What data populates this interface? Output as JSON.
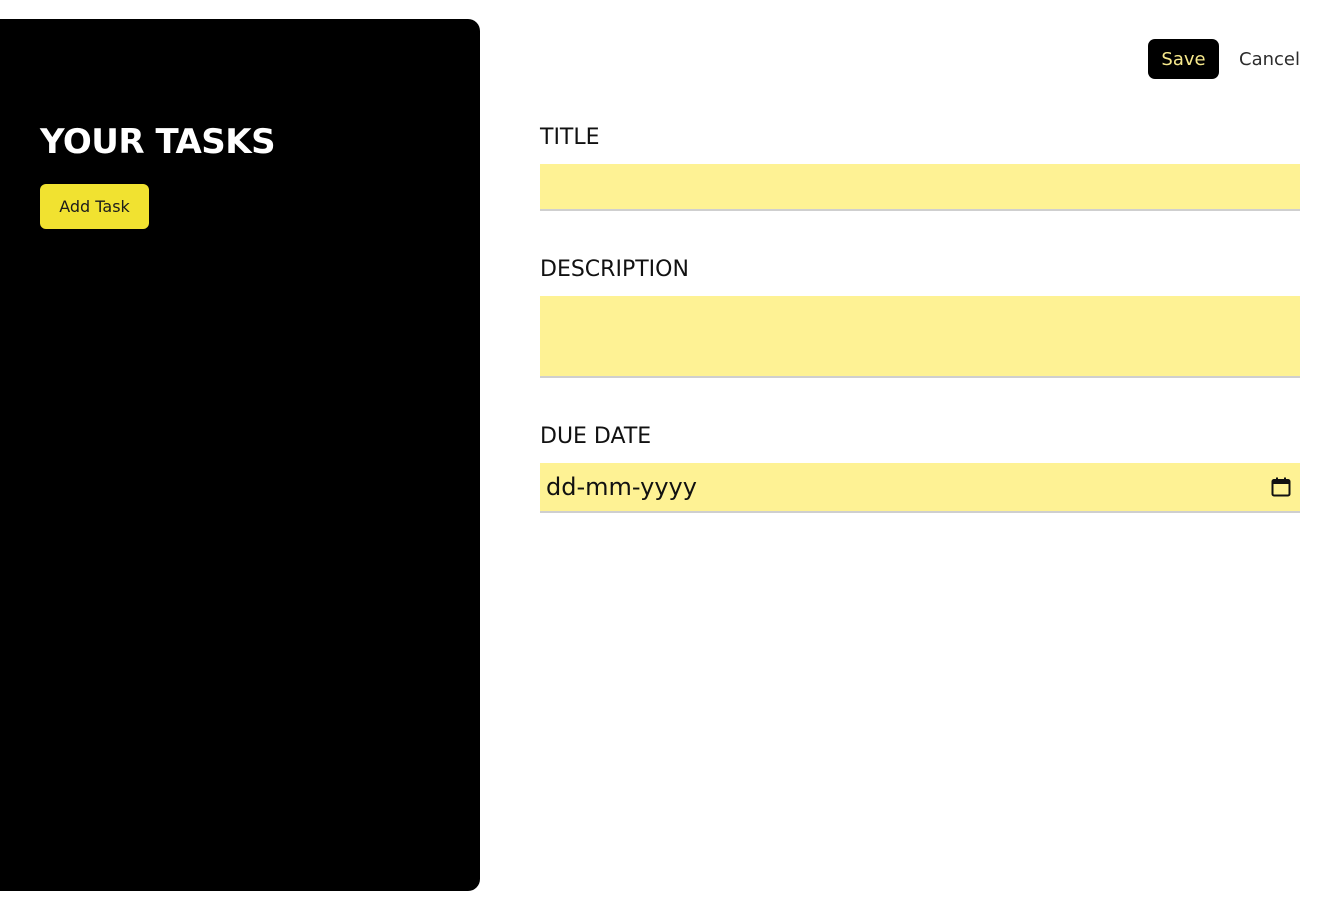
{
  "sidebar": {
    "title": "YOUR TASKS",
    "add_task_label": "Add Task"
  },
  "actions": {
    "save_label": "Save",
    "cancel_label": "Cancel"
  },
  "form": {
    "title": {
      "label": "TITLE",
      "value": ""
    },
    "description": {
      "label": "DESCRIPTION",
      "value": ""
    },
    "due_date": {
      "label": "DUE DATE",
      "placeholder": "dd-mm-yyyy",
      "icon": "calendar-icon"
    }
  },
  "colors": {
    "sidebar_bg": "#000000",
    "add_button_bg": "#f1e230",
    "field_bg": "#fef294",
    "save_text": "#f7e98c"
  }
}
